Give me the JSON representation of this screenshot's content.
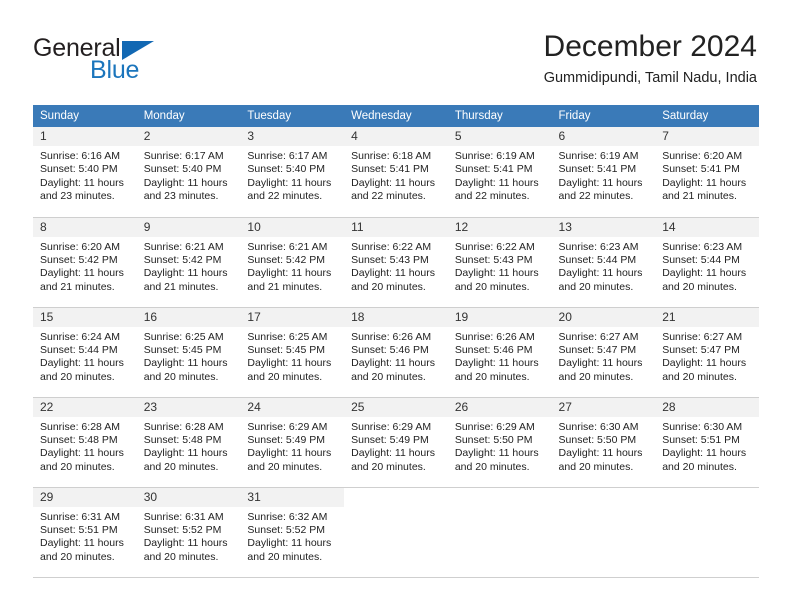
{
  "brand": {
    "name_part1": "General",
    "name_part2": "Blue",
    "accent_color": "#1b75bc",
    "triangle_color": "#1268b3"
  },
  "header": {
    "title": "December 2024",
    "subtitle": "Gummidipundi, Tamil Nadu, India"
  },
  "calendar": {
    "header_color": "#3a7ab8",
    "weekday_headers": [
      "Sunday",
      "Monday",
      "Tuesday",
      "Wednesday",
      "Thursday",
      "Friday",
      "Saturday"
    ],
    "weeks": [
      [
        {
          "day": "1",
          "sunrise": "Sunrise: 6:16 AM",
          "sunset": "Sunset: 5:40 PM",
          "daylight_line1": "Daylight: 11 hours",
          "daylight_line2": "and 23 minutes."
        },
        {
          "day": "2",
          "sunrise": "Sunrise: 6:17 AM",
          "sunset": "Sunset: 5:40 PM",
          "daylight_line1": "Daylight: 11 hours",
          "daylight_line2": "and 23 minutes."
        },
        {
          "day": "3",
          "sunrise": "Sunrise: 6:17 AM",
          "sunset": "Sunset: 5:40 PM",
          "daylight_line1": "Daylight: 11 hours",
          "daylight_line2": "and 22 minutes."
        },
        {
          "day": "4",
          "sunrise": "Sunrise: 6:18 AM",
          "sunset": "Sunset: 5:41 PM",
          "daylight_line1": "Daylight: 11 hours",
          "daylight_line2": "and 22 minutes."
        },
        {
          "day": "5",
          "sunrise": "Sunrise: 6:19 AM",
          "sunset": "Sunset: 5:41 PM",
          "daylight_line1": "Daylight: 11 hours",
          "daylight_line2": "and 22 minutes."
        },
        {
          "day": "6",
          "sunrise": "Sunrise: 6:19 AM",
          "sunset": "Sunset: 5:41 PM",
          "daylight_line1": "Daylight: 11 hours",
          "daylight_line2": "and 22 minutes."
        },
        {
          "day": "7",
          "sunrise": "Sunrise: 6:20 AM",
          "sunset": "Sunset: 5:41 PM",
          "daylight_line1": "Daylight: 11 hours",
          "daylight_line2": "and 21 minutes."
        }
      ],
      [
        {
          "day": "8",
          "sunrise": "Sunrise: 6:20 AM",
          "sunset": "Sunset: 5:42 PM",
          "daylight_line1": "Daylight: 11 hours",
          "daylight_line2": "and 21 minutes."
        },
        {
          "day": "9",
          "sunrise": "Sunrise: 6:21 AM",
          "sunset": "Sunset: 5:42 PM",
          "daylight_line1": "Daylight: 11 hours",
          "daylight_line2": "and 21 minutes."
        },
        {
          "day": "10",
          "sunrise": "Sunrise: 6:21 AM",
          "sunset": "Sunset: 5:42 PM",
          "daylight_line1": "Daylight: 11 hours",
          "daylight_line2": "and 21 minutes."
        },
        {
          "day": "11",
          "sunrise": "Sunrise: 6:22 AM",
          "sunset": "Sunset: 5:43 PM",
          "daylight_line1": "Daylight: 11 hours",
          "daylight_line2": "and 20 minutes."
        },
        {
          "day": "12",
          "sunrise": "Sunrise: 6:22 AM",
          "sunset": "Sunset: 5:43 PM",
          "daylight_line1": "Daylight: 11 hours",
          "daylight_line2": "and 20 minutes."
        },
        {
          "day": "13",
          "sunrise": "Sunrise: 6:23 AM",
          "sunset": "Sunset: 5:44 PM",
          "daylight_line1": "Daylight: 11 hours",
          "daylight_line2": "and 20 minutes."
        },
        {
          "day": "14",
          "sunrise": "Sunrise: 6:23 AM",
          "sunset": "Sunset: 5:44 PM",
          "daylight_line1": "Daylight: 11 hours",
          "daylight_line2": "and 20 minutes."
        }
      ],
      [
        {
          "day": "15",
          "sunrise": "Sunrise: 6:24 AM",
          "sunset": "Sunset: 5:44 PM",
          "daylight_line1": "Daylight: 11 hours",
          "daylight_line2": "and 20 minutes."
        },
        {
          "day": "16",
          "sunrise": "Sunrise: 6:25 AM",
          "sunset": "Sunset: 5:45 PM",
          "daylight_line1": "Daylight: 11 hours",
          "daylight_line2": "and 20 minutes."
        },
        {
          "day": "17",
          "sunrise": "Sunrise: 6:25 AM",
          "sunset": "Sunset: 5:45 PM",
          "daylight_line1": "Daylight: 11 hours",
          "daylight_line2": "and 20 minutes."
        },
        {
          "day": "18",
          "sunrise": "Sunrise: 6:26 AM",
          "sunset": "Sunset: 5:46 PM",
          "daylight_line1": "Daylight: 11 hours",
          "daylight_line2": "and 20 minutes."
        },
        {
          "day": "19",
          "sunrise": "Sunrise: 6:26 AM",
          "sunset": "Sunset: 5:46 PM",
          "daylight_line1": "Daylight: 11 hours",
          "daylight_line2": "and 20 minutes."
        },
        {
          "day": "20",
          "sunrise": "Sunrise: 6:27 AM",
          "sunset": "Sunset: 5:47 PM",
          "daylight_line1": "Daylight: 11 hours",
          "daylight_line2": "and 20 minutes."
        },
        {
          "day": "21",
          "sunrise": "Sunrise: 6:27 AM",
          "sunset": "Sunset: 5:47 PM",
          "daylight_line1": "Daylight: 11 hours",
          "daylight_line2": "and 20 minutes."
        }
      ],
      [
        {
          "day": "22",
          "sunrise": "Sunrise: 6:28 AM",
          "sunset": "Sunset: 5:48 PM",
          "daylight_line1": "Daylight: 11 hours",
          "daylight_line2": "and 20 minutes."
        },
        {
          "day": "23",
          "sunrise": "Sunrise: 6:28 AM",
          "sunset": "Sunset: 5:48 PM",
          "daylight_line1": "Daylight: 11 hours",
          "daylight_line2": "and 20 minutes."
        },
        {
          "day": "24",
          "sunrise": "Sunrise: 6:29 AM",
          "sunset": "Sunset: 5:49 PM",
          "daylight_line1": "Daylight: 11 hours",
          "daylight_line2": "and 20 minutes."
        },
        {
          "day": "25",
          "sunrise": "Sunrise: 6:29 AM",
          "sunset": "Sunset: 5:49 PM",
          "daylight_line1": "Daylight: 11 hours",
          "daylight_line2": "and 20 minutes."
        },
        {
          "day": "26",
          "sunrise": "Sunrise: 6:29 AM",
          "sunset": "Sunset: 5:50 PM",
          "daylight_line1": "Daylight: 11 hours",
          "daylight_line2": "and 20 minutes."
        },
        {
          "day": "27",
          "sunrise": "Sunrise: 6:30 AM",
          "sunset": "Sunset: 5:50 PM",
          "daylight_line1": "Daylight: 11 hours",
          "daylight_line2": "and 20 minutes."
        },
        {
          "day": "28",
          "sunrise": "Sunrise: 6:30 AM",
          "sunset": "Sunset: 5:51 PM",
          "daylight_line1": "Daylight: 11 hours",
          "daylight_line2": "and 20 minutes."
        }
      ],
      [
        {
          "day": "29",
          "sunrise": "Sunrise: 6:31 AM",
          "sunset": "Sunset: 5:51 PM",
          "daylight_line1": "Daylight: 11 hours",
          "daylight_line2": "and 20 minutes."
        },
        {
          "day": "30",
          "sunrise": "Sunrise: 6:31 AM",
          "sunset": "Sunset: 5:52 PM",
          "daylight_line1": "Daylight: 11 hours",
          "daylight_line2": "and 20 minutes."
        },
        {
          "day": "31",
          "sunrise": "Sunrise: 6:32 AM",
          "sunset": "Sunset: 5:52 PM",
          "daylight_line1": "Daylight: 11 hours",
          "daylight_line2": "and 20 minutes."
        },
        null,
        null,
        null,
        null
      ]
    ]
  }
}
